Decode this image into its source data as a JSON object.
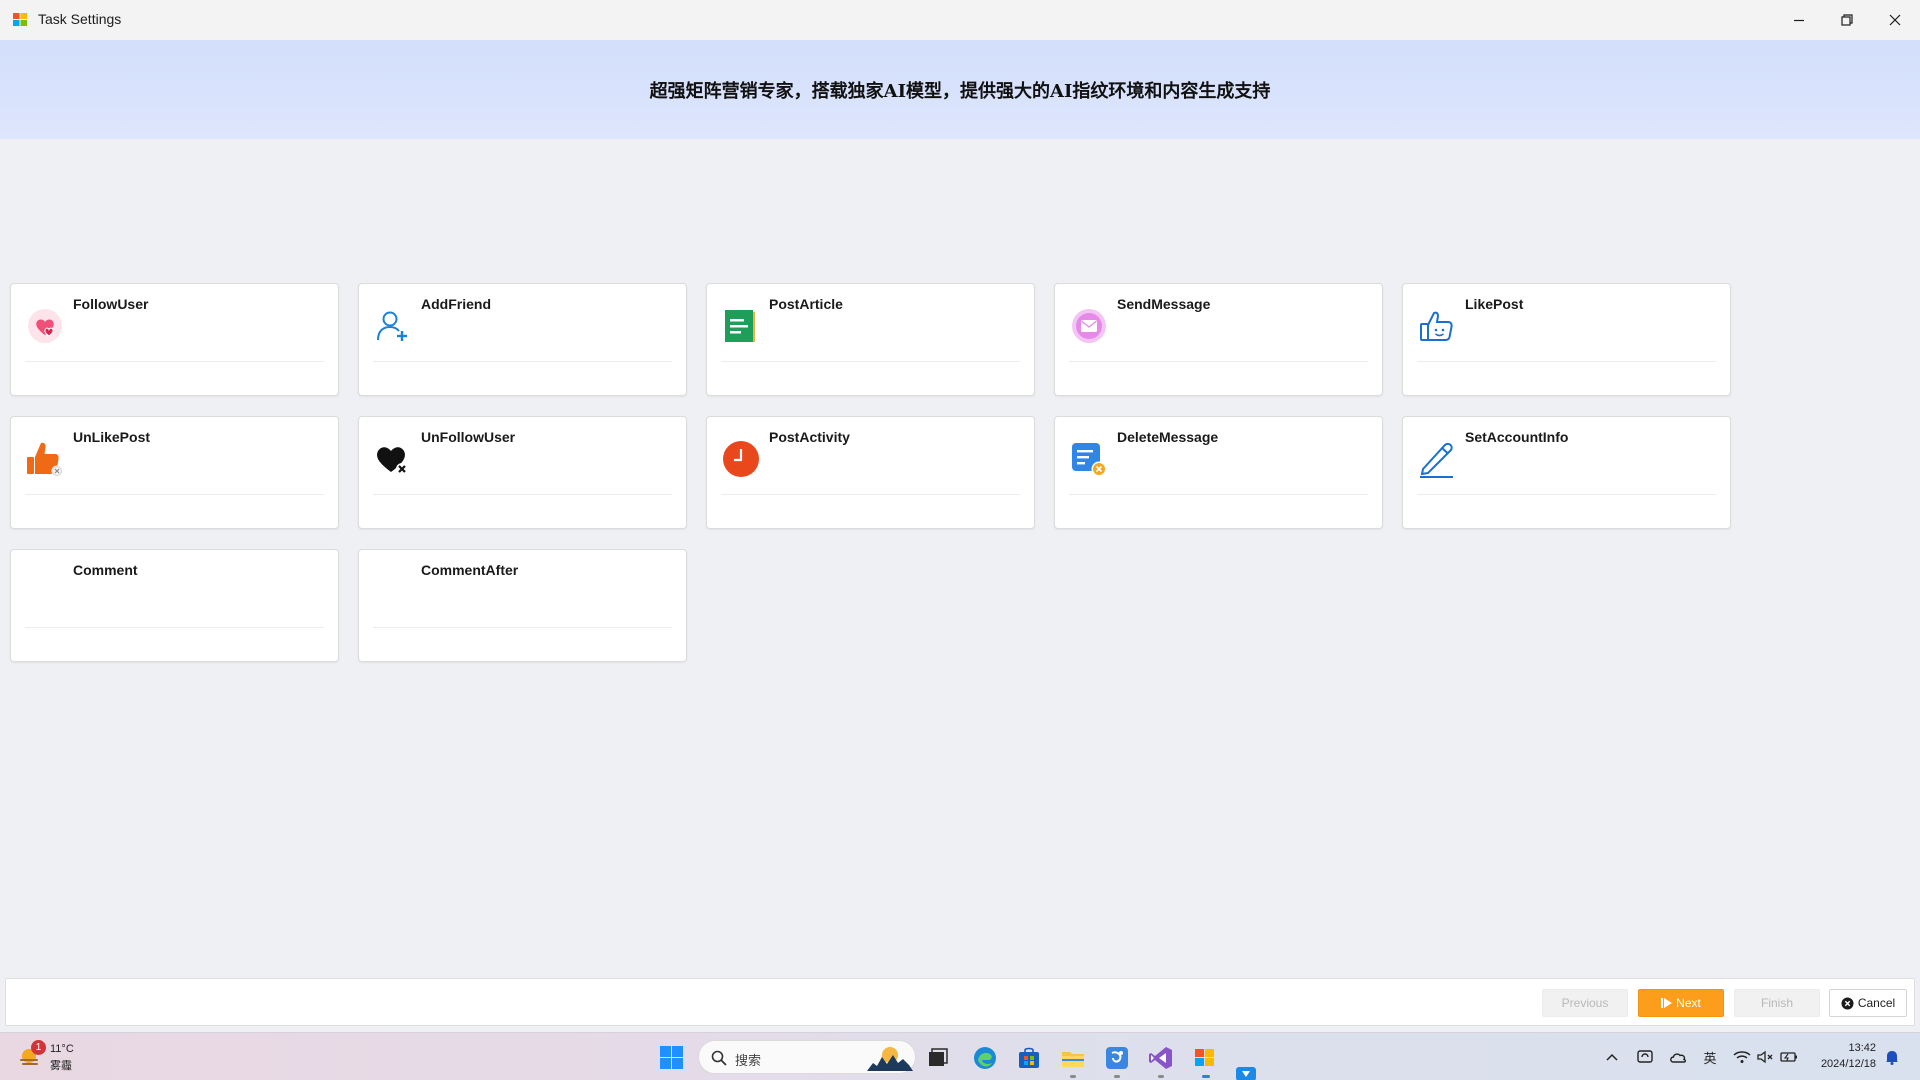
{
  "window": {
    "title": "Task Settings",
    "minimize_icon": "minimize-icon",
    "restore_icon": "restore-icon",
    "close_icon": "close-icon"
  },
  "banner": {
    "text": "超强矩阵营销专家，搭载独家AI模型，提供强大的AI指纹环境和内容生成支持"
  },
  "tasks": [
    {
      "label": "FollowUser",
      "icon": "heart-icon"
    },
    {
      "label": "AddFriend",
      "icon": "add-user-icon"
    },
    {
      "label": "PostArticle",
      "icon": "document-icon"
    },
    {
      "label": "SendMessage",
      "icon": "envelope-icon"
    },
    {
      "label": "LikePost",
      "icon": "thumbs-up-icon"
    },
    {
      "label": "UnLikePost",
      "icon": "thumbs-up-remove-icon"
    },
    {
      "label": "UnFollowUser",
      "icon": "heart-remove-icon"
    },
    {
      "label": "PostActivity",
      "icon": "clock-icon"
    },
    {
      "label": "DeleteMessage",
      "icon": "delete-message-icon"
    },
    {
      "label": "SetAccountInfo",
      "icon": "pen-icon"
    },
    {
      "label": "Comment",
      "icon": ""
    },
    {
      "label": "CommentAfter",
      "icon": ""
    }
  ],
  "footer": {
    "previous": "Previous",
    "next": "Next",
    "finish": "Finish",
    "cancel": "Cancel"
  },
  "taskbar": {
    "weather_badge": "1",
    "temperature": "11°C",
    "condition": "雾霾",
    "search_placeholder": "搜索",
    "ime": "英",
    "time": "13:42",
    "date": "2024/12/18"
  },
  "colors": {
    "accent_next": "#fc9d1c",
    "banner": "#d3defb",
    "background": "#eff0f3"
  }
}
